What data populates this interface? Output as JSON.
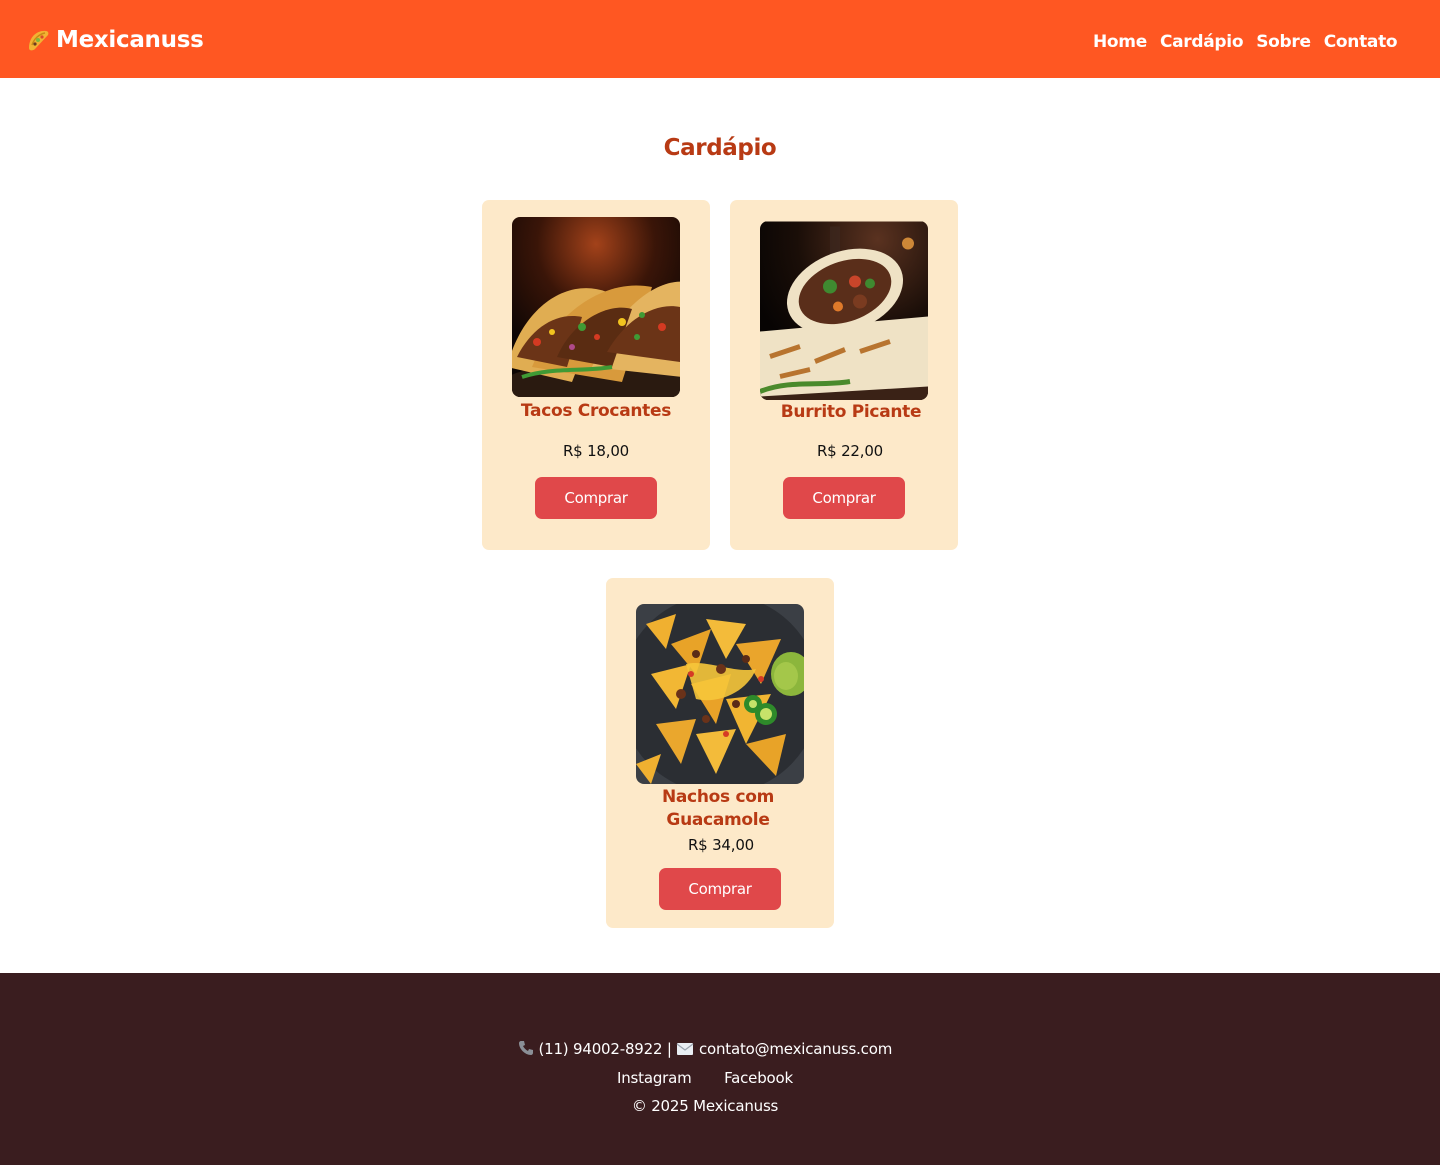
{
  "header": {
    "logo_icon": "taco-icon",
    "brand": "Mexicanuss",
    "nav": [
      {
        "label": "Home"
      },
      {
        "label": "Cardápio"
      },
      {
        "label": "Sobre"
      },
      {
        "label": "Contato"
      }
    ]
  },
  "menu": {
    "title": "Cardápio",
    "items": [
      {
        "name": "Tacos Crocantes",
        "price": "R$ 18,00",
        "button": "Comprar",
        "image": "tacos-photo"
      },
      {
        "name": "Burrito Picante",
        "price": "R$ 22,00",
        "button": "Comprar",
        "image": "burrito-photo"
      },
      {
        "name": "Nachos com Guacamole",
        "price": "R$ 34,00",
        "button": "Comprar",
        "image": "nachos-photo"
      }
    ]
  },
  "footer": {
    "phone_icon": "phone-icon",
    "phone": "(11) 94002-8922",
    "separator": "|",
    "email_icon": "envelope-icon",
    "email": "contato@mexicanuss.com",
    "social": [
      {
        "label": "Instagram"
      },
      {
        "label": "Facebook"
      }
    ],
    "copyright": "© 2025 Mexicanuss"
  },
  "colors": {
    "header_bg": "#ff5722",
    "accent_text": "#b83a14",
    "card_bg": "#fde9c9",
    "button_bg": "#e0484a",
    "footer_bg": "#3a1d1f"
  }
}
